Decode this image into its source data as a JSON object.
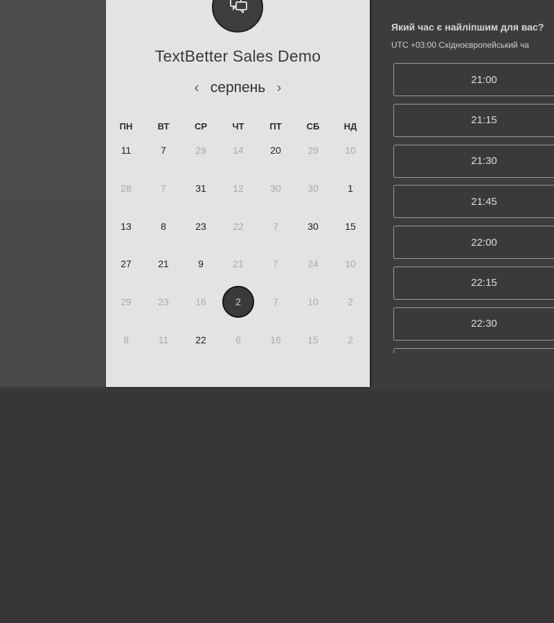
{
  "booking": {
    "title": "TextBetter Sales Demo"
  },
  "calendar": {
    "month": "серпень",
    "prev_icon": "‹",
    "next_icon": "›",
    "weekdays": [
      "ПН",
      "ВТ",
      "СР",
      "ЧТ",
      "ПТ",
      "СБ",
      "НД"
    ],
    "days": [
      {
        "label": "11",
        "state": "available"
      },
      {
        "label": "7",
        "state": "available"
      },
      {
        "label": "29",
        "state": "disabled"
      },
      {
        "label": "14",
        "state": "disabled"
      },
      {
        "label": "20",
        "state": "available"
      },
      {
        "label": "29",
        "state": "disabled"
      },
      {
        "label": "10",
        "state": "disabled"
      },
      {
        "label": "28",
        "state": "disabled"
      },
      {
        "label": "7",
        "state": "disabled"
      },
      {
        "label": "31",
        "state": "available"
      },
      {
        "label": "12",
        "state": "disabled"
      },
      {
        "label": "30",
        "state": "disabled"
      },
      {
        "label": "30",
        "state": "disabled"
      },
      {
        "label": "1",
        "state": "available"
      },
      {
        "label": "13",
        "state": "available"
      },
      {
        "label": "8",
        "state": "available"
      },
      {
        "label": "23",
        "state": "available"
      },
      {
        "label": "22",
        "state": "disabled"
      },
      {
        "label": "7",
        "state": "disabled"
      },
      {
        "label": "30",
        "state": "available"
      },
      {
        "label": "15",
        "state": "available"
      },
      {
        "label": "27",
        "state": "available"
      },
      {
        "label": "21",
        "state": "available"
      },
      {
        "label": "9",
        "state": "available"
      },
      {
        "label": "21",
        "state": "disabled"
      },
      {
        "label": "7",
        "state": "disabled"
      },
      {
        "label": "24",
        "state": "disabled"
      },
      {
        "label": "10",
        "state": "disabled"
      },
      {
        "label": "29",
        "state": "disabled"
      },
      {
        "label": "23",
        "state": "disabled"
      },
      {
        "label": "16",
        "state": "disabled"
      },
      {
        "label": "2",
        "state": "selected"
      },
      {
        "label": "7",
        "state": "disabled"
      },
      {
        "label": "10",
        "state": "disabled"
      },
      {
        "label": "2",
        "state": "disabled"
      },
      {
        "label": "8",
        "state": "disabled"
      },
      {
        "label": "11",
        "state": "disabled"
      },
      {
        "label": "22",
        "state": "available"
      },
      {
        "label": "6",
        "state": "disabled"
      },
      {
        "label": "16",
        "state": "disabled"
      },
      {
        "label": "15",
        "state": "disabled"
      },
      {
        "label": "2",
        "state": "disabled"
      }
    ]
  },
  "times": {
    "question": "Який час є найліпшим для вас?",
    "timezone": "UTC +03:00 Східноєвропейський ча",
    "slots": [
      "21:00",
      "21:15",
      "21:30",
      "21:45",
      "22:00",
      "22:15",
      "22:30"
    ]
  },
  "icons": {
    "logo": "chat-bubbles-icon"
  }
}
